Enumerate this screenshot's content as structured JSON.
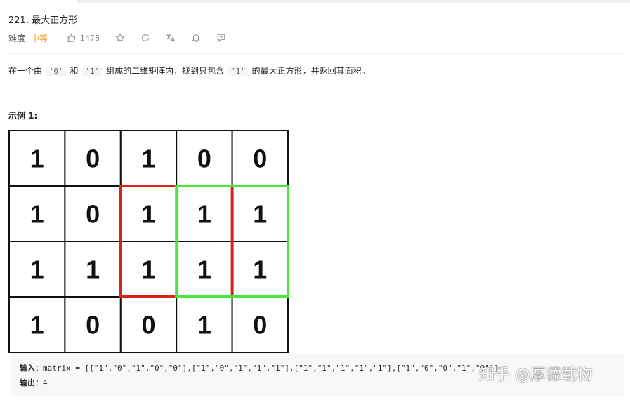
{
  "header": {
    "title": "221. 最大正方形"
  },
  "meta": {
    "difficulty_label": "难度",
    "difficulty_value": "中等",
    "like_count": "1478",
    "icons": [
      "thumb-up-icon",
      "star-icon",
      "share-icon",
      "translate-icon",
      "bell-icon",
      "comment-icon"
    ]
  },
  "description": {
    "t1": "在一个由",
    "c1": "'0'",
    "t2": "和",
    "c2": "'1'",
    "t3": "组成的二维矩阵内，找到只包含",
    "c3": "'1'",
    "t4": "的最大正方形，并返回其面积。"
  },
  "example": {
    "title": "示例 1:",
    "matrix": [
      [
        "1",
        "0",
        "1",
        "0",
        "0"
      ],
      [
        "1",
        "0",
        "1",
        "1",
        "1"
      ],
      [
        "1",
        "1",
        "1",
        "1",
        "1"
      ],
      [
        "1",
        "0",
        "0",
        "1",
        "0"
      ]
    ],
    "highlights": [
      {
        "color": "#d9221a",
        "rows": [
          1,
          2
        ],
        "cols": [
          2,
          3
        ]
      },
      {
        "color": "#45e83c",
        "rows": [
          1,
          2
        ],
        "cols": [
          3,
          4
        ]
      }
    ],
    "input_label": "输入：",
    "input_value": "matrix = [[\"1\",\"0\",\"1\",\"0\",\"0\"],[\"1\",\"0\",\"1\",\"1\",\"1\"],[\"1\",\"1\",\"1\",\"1\",\"1\"],[\"1\",\"0\",\"0\",\"1\",\"0\"]]",
    "output_label": "输出：",
    "output_value": "4"
  },
  "watermark": "知乎 @厚德载物"
}
